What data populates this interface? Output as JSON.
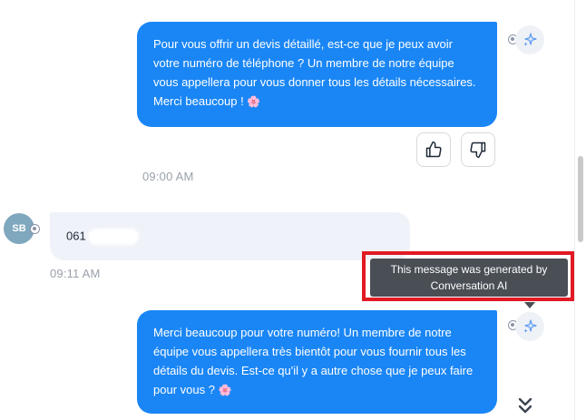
{
  "messages": {
    "bot_1": {
      "text": "Pour vous offrir un devis détaillé, est-ce que je peux avoir votre numéro de téléphone ? Un membre de notre équipe vous appellera pour vous donner tous les détails nécessaires. Merci beaucoup !",
      "emoji": "🌸",
      "time": "09:00 AM"
    },
    "user_1": {
      "initials": "SB",
      "text": "061",
      "time": "09:11 AM"
    },
    "bot_2": {
      "text": "Merci beaucoup pour votre numéro! Un membre de notre équipe vous appellera très bientôt pour vous fournir tous les détails du devis. Est-ce qu'il y a autre chose que je peux faire pour vous ?",
      "emoji": "🌸"
    }
  },
  "tooltip": {
    "text": "This message was generated by Conversation AI"
  },
  "icons": {
    "ai_avatar": "sparkle-icon",
    "channel_badge": "instagram-icon",
    "thumbs_up": "thumbs-up-icon",
    "thumbs_down": "thumbs-down-icon",
    "scroll_down": "double-chevron-down-icon"
  },
  "colors": {
    "outgoing_bubble": "#1a86f5",
    "incoming_bubble": "#eff2f8",
    "user_avatar": "#7fa7be",
    "tooltip_bg": "#4a4f55",
    "highlight_frame": "#e11a24"
  }
}
